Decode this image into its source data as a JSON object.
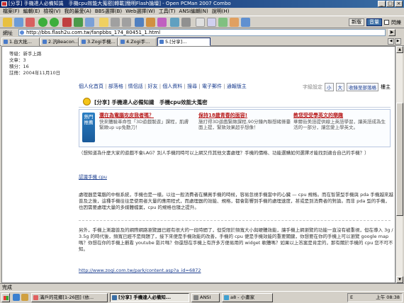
{
  "window": {
    "title": "[分享] 手機達人必備知識　手機cpu效能大蒐密[轉載]簡明Flash論壇] - Open PCMan 2007 Combo",
    "minimize": "_",
    "maximize": "□",
    "close": "×"
  },
  "menu": [
    "檔案(F)",
    "編輯(E)",
    "檢視(V)",
    "我的最愛(A)",
    "BBS選擇(B)",
    "Web選擇(W)",
    "工具(T)",
    "ANSI編輯(N)",
    "說明(H)"
  ],
  "toolbar": {
    "right_buttons": [
      "新版",
      "音量"
    ],
    "toggle_label": "閃爍"
  },
  "address": {
    "label": "網址",
    "url": "http://bbs.flash2u.com.tw/fanpbbs_174_80451_1.html",
    "go_label": "▶"
  },
  "tabs": [
    {
      "label": "1.台大批..."
    },
    {
      "label": "2.汎Beacon..."
    },
    {
      "label": "3.Zogi手機..."
    },
    {
      "label": "4.Zogi手..."
    },
    {
      "label": "5.[分享]..."
    }
  ],
  "profile": {
    "level": "等級：新手上路",
    "posts": "文章：3",
    "points": "積分：16",
    "registered": "註冊：2004年11月10日"
  },
  "forum_nav": {
    "links": [
      "個人化首頁",
      "部落格",
      "情侶話",
      "好友",
      "個人資料",
      "搜尋",
      "電子郵件",
      "通報版主"
    ],
    "font_label": "字級設定",
    "font_small": "小",
    "font_large": "大",
    "favorite": "收錄至部落格",
    "floor": "樓主"
  },
  "post": {
    "title": "[分享] 手機達人必備知識　手機cpu效能大蒐密"
  },
  "ads": {
    "badge": "熱門推薦",
    "items": [
      {
        "headline": "還在為電腦攻皮我者嗎？",
        "text": "快來體驗革命性「3D遊戲製遊」課程，肌膚緊緻up up免動刀！"
      },
      {
        "headline": "保持18歲青春的面容!",
        "text": "施打得3D遊戲緊緻課程,90分鐘內聯想緒條臺面上提，緊致效果超乎想像！"
      },
      {
        "headline": "教您受受學英文的樂趣",
        "text": "華爾街美語提供線上英語學習，讓英語成為生活的一部分，讓您愛上學英文。"
      }
    ]
  },
  "content": {
    "intro": "（想知道為什麼大家的遊戲不會LAG？別人手機同時可以上網又作其他文書處理？手機的價格、功能選購如何選擇才能找到適合自己的手機？）",
    "link1": "認識手機 cpu",
    "para1": "處理器是電腦的中樞系統，手機也是一樣。以往一般消費者在購買手機的時候，容易忽視手機當中的心臟 — cpu 規格。而在智慧型手機與 pda 手機越來越普及之後，這種手機往往是使用者大量的應用程式，而處理器的效能、規格，都會影響到手機的處理速度，甚或是到消費者的對論。而非 pda 型的手機，也因需要處理大量的多媒體檔案，cpu 的規格也隨之提升。",
    "para2": "另外，手機上漸趨普及的網際網路瀏覽器已經有很大的一段時間了，但受限於頻寬大小與硬體效能，讓手機上網瀏覽的功能一直沒有被重視，但在導入 3g / 3.5g 的時代後，頻寬已經不是問題了，接下來便是手機效能的改善，手機的 cpu 便是手機效能的重要關鍵，你想要在你的手機上可以瀏覽 google map 嗎？你想在你的手機上觀看 youtube 影片嗎？你還想在手機上有許多方便易用的 widget 軟體嗎？如果以上答案是肯定的，那有關於手機的 cpu 您不可不知。",
    "link2": "http://www.zogi.com.tw/park/content.asp?a_id=6872"
  },
  "statusbar": {
    "text": "完成"
  },
  "taskbar": {
    "tasks": [
      {
        "label": "滿戶的花鄉[1-26回] (依..."
      },
      {
        "label": "[分享] 手機達人必備知..."
      },
      {
        "label": "ANSI"
      },
      {
        "label": "a8 - 小畫家"
      }
    ],
    "ime": "E",
    "clock": "上午 08:38"
  },
  "colors": {
    "title_gradient_start": "#0a246a",
    "title_gradient_end": "#3a6ea5",
    "link": "#1a3d8f",
    "ad_headline": "#b81c1c"
  }
}
